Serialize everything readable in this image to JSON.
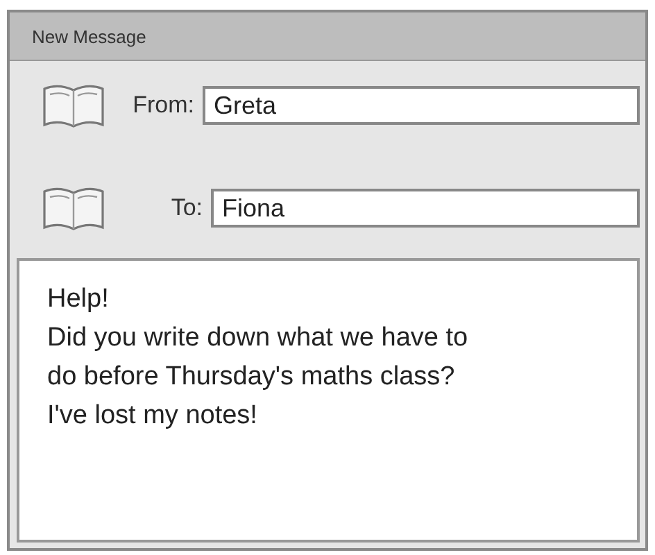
{
  "window": {
    "title": "New Message"
  },
  "fields": [
    {
      "label": "From:",
      "value": "Greta"
    },
    {
      "label": "To:",
      "value": "Fiona"
    }
  ],
  "message": {
    "lines": [
      "Help!",
      "Did you write down what we have to",
      "do before Thursday's maths class?",
      "I've lost my notes!"
    ]
  }
}
